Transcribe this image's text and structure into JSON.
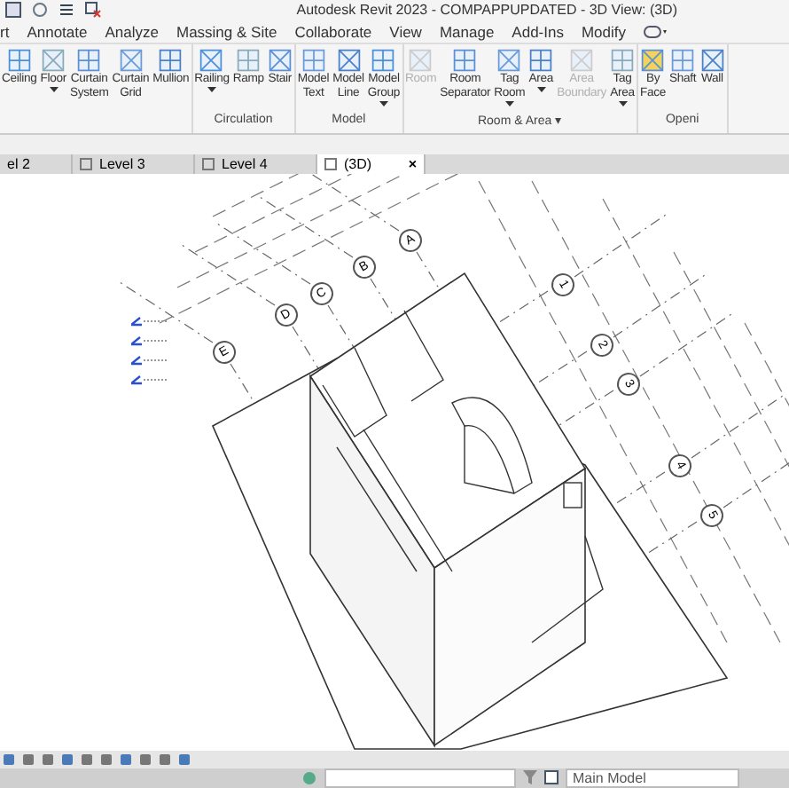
{
  "window": {
    "title": "Autodesk Revit 2023 - COMPAPPUPDATED - 3D View: (3D)"
  },
  "menu_tabs": [
    {
      "label": "rt",
      "selected": false
    },
    {
      "label": "Annotate",
      "selected": false
    },
    {
      "label": "Analyze",
      "selected": false
    },
    {
      "label": "Massing & Site",
      "selected": false
    },
    {
      "label": "Collaborate",
      "selected": false
    },
    {
      "label": "View",
      "selected": false
    },
    {
      "label": "Manage",
      "selected": false
    },
    {
      "label": "Add-Ins",
      "selected": false
    },
    {
      "label": "Modify",
      "selected": false
    }
  ],
  "ribbon_groups": [
    {
      "buttons": [
        {
          "label": "Ceiling",
          "disabled": false,
          "has_menu": false
        },
        {
          "label": "Floor",
          "disabled": false,
          "has_menu": true
        },
        {
          "label": "Curtain System",
          "disabled": false,
          "has_menu": false
        },
        {
          "label": "Curtain Grid",
          "disabled": false,
          "has_menu": false
        },
        {
          "label": "Mullion",
          "disabled": false,
          "has_menu": false
        }
      ]
    },
    {
      "label": "Circulation",
      "buttons": [
        {
          "label": "Railing",
          "disabled": false,
          "has_menu": true
        },
        {
          "label": "Ramp",
          "disabled": false,
          "has_menu": false
        },
        {
          "label": "Stair",
          "disabled": false,
          "has_menu": false
        }
      ]
    },
    {
      "label": "Model",
      "buttons": [
        {
          "label": "Model Text",
          "disabled": false,
          "has_menu": false
        },
        {
          "label": "Model Line",
          "disabled": false,
          "has_menu": false
        },
        {
          "label": "Model Group",
          "disabled": false,
          "has_menu": true
        }
      ]
    },
    {
      "label": "Room & Area ▾",
      "buttons": [
        {
          "label": "Room",
          "disabled": true,
          "has_menu": false
        },
        {
          "label": "Room Separator",
          "disabled": false,
          "has_menu": false
        },
        {
          "label": "Tag Room",
          "disabled": false,
          "has_menu": true
        },
        {
          "label": "Area",
          "disabled": false,
          "has_menu": true
        },
        {
          "label": "Area Boundary",
          "disabled": true,
          "has_menu": false
        },
        {
          "label": "Tag Area",
          "disabled": false,
          "has_menu": true
        }
      ]
    },
    {
      "label": "Openi",
      "buttons": [
        {
          "label": "By Face",
          "disabled": false,
          "has_menu": false
        },
        {
          "label": "Shaft",
          "disabled": false,
          "has_menu": false
        },
        {
          "label": "Wall",
          "disabled": false,
          "has_menu": false
        }
      ]
    }
  ],
  "view_tabs": [
    {
      "label": "el 2",
      "selected": false
    },
    {
      "label": "Level 3",
      "selected": false
    },
    {
      "label": "Level 4",
      "selected": false
    },
    {
      "label": "(3D)",
      "selected": true,
      "close": "×"
    }
  ],
  "grid_bubbles": [
    {
      "label": "A"
    },
    {
      "label": "B"
    },
    {
      "label": "C"
    },
    {
      "label": "D"
    },
    {
      "label": "E"
    },
    {
      "label": "1"
    },
    {
      "label": "2"
    },
    {
      "label": "3"
    },
    {
      "label": "4"
    },
    {
      "label": "5"
    }
  ],
  "status_bar": {
    "workset": "Main Model"
  }
}
